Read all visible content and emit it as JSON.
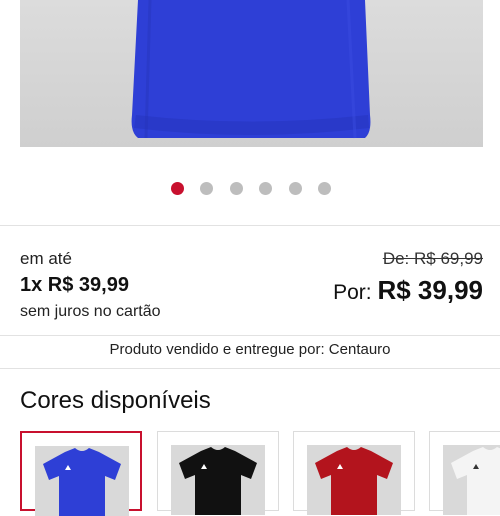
{
  "gallery": {
    "image_alt": "camisa azul",
    "dots": [
      {
        "active": true
      },
      {
        "active": false
      },
      {
        "active": false
      },
      {
        "active": false
      },
      {
        "active": false
      },
      {
        "active": false
      }
    ],
    "accent_color": "#c8102e",
    "inactive_color": "#bdbdbd"
  },
  "pricing": {
    "installments_prefix": "em até",
    "installments": "1x R$ 39,99",
    "no_interest": "sem juros no cartão",
    "old_price": "De: R$ 69,99",
    "new_price_label": "Por:",
    "new_price": "R$ 39,99"
  },
  "seller": {
    "text": "Produto vendido e entregue por: Centauro"
  },
  "colors": {
    "title": "Cores disponíveis",
    "options": [
      {
        "name": "azul",
        "hex": "#2e3fd6",
        "selected": true
      },
      {
        "name": "preto",
        "hex": "#111111",
        "selected": false
      },
      {
        "name": "vermelho",
        "hex": "#b3141d",
        "selected": false
      },
      {
        "name": "branco",
        "hex": "#f4f4f4",
        "selected": false
      }
    ]
  }
}
